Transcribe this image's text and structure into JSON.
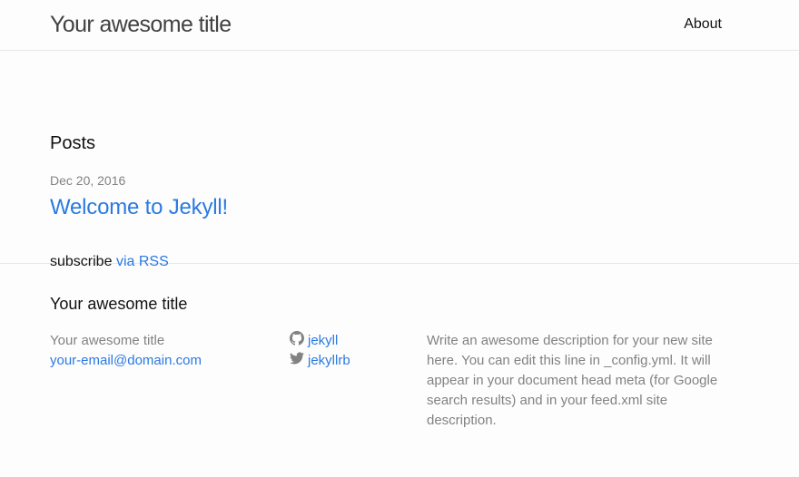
{
  "header": {
    "site_title": "Your awesome title",
    "nav_about": "About"
  },
  "main": {
    "posts_heading": "Posts",
    "posts": [
      {
        "date": "Dec 20, 2016",
        "title": "Welcome to Jekyll!"
      }
    ],
    "subscribe_text": "subscribe",
    "rss_link": "via RSS"
  },
  "footer": {
    "heading": "Your awesome title",
    "col1_title": "Your awesome title",
    "email": "your-email@domain.com",
    "github_user": "jekyll",
    "twitter_user": "jekyllrb",
    "description": "Write an awesome description for your new site here. You can edit this line in _config.yml. It will appear in your document head meta (for Google search results) and in your feed.xml site description."
  },
  "colors": {
    "link": "#2a7ae2",
    "meta_gray": "#828282",
    "text": "#111111",
    "border": "#e8e8e8"
  },
  "icons": [
    "github-icon",
    "twitter-icon"
  ]
}
